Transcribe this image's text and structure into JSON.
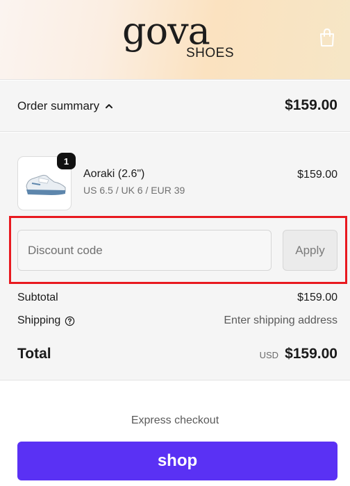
{
  "brand": {
    "name": "gova",
    "subtitle": "SHOES"
  },
  "header": {
    "cart_icon": "shopping-bag-icon"
  },
  "summary": {
    "label": "Order summary",
    "total": "$159.00"
  },
  "product": {
    "quantity": "1",
    "name": "Aoraki (2.6\")",
    "variant": "US 6.5 / UK 6 / EUR 39",
    "price": "$159.00"
  },
  "discount": {
    "placeholder": "Discount code",
    "apply_label": "Apply"
  },
  "totals": {
    "subtotal_label": "Subtotal",
    "subtotal_value": "$159.00",
    "shipping_label": "Shipping",
    "shipping_value": "Enter shipping address",
    "total_label": "Total",
    "currency": "USD",
    "total_value": "$159.00"
  },
  "checkout": {
    "express_label": "Express checkout",
    "shop_button_label": "shop"
  },
  "colors": {
    "shop_pay": "#5a31f4",
    "highlight": "#e8191f"
  }
}
